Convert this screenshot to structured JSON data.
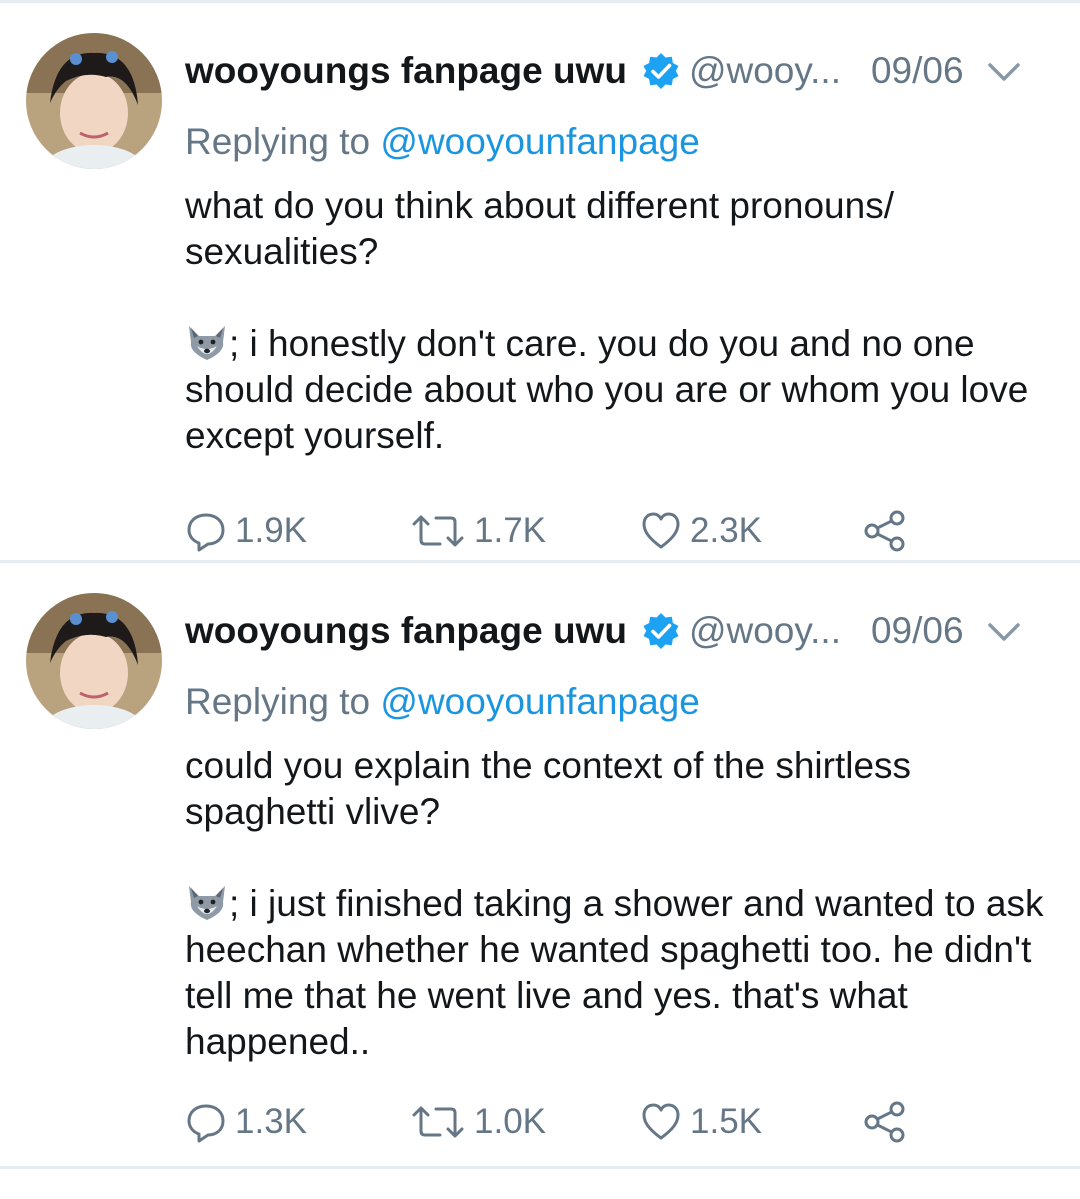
{
  "tweets": [
    {
      "author_name": "wooyoungs fanpage uwu",
      "handle": "@wooy...",
      "date": "09/06",
      "replying_prefix": "Replying to",
      "replying_to": "@wooyounfanpage",
      "question": "what do you think about different pronouns/ sexualities?",
      "answer": "; i honestly don't care. you do you and no one should decide about who you are or whom you love except yourself.",
      "answer_icon": "wolf-emoji",
      "replies": "1.9K",
      "retweets": "1.7K",
      "likes": "2.3K"
    },
    {
      "author_name": "wooyoungs fanpage uwu",
      "handle": "@wooy...",
      "date": "09/06",
      "replying_prefix": "Replying to",
      "replying_to": "@wooyounfanpage",
      "question": "could you explain the context of the shirtless spaghetti vlive?",
      "answer": "; i just finished taking a shower and wanted to ask heechan whether he wanted spaghetti too. he didn't tell me that he went live and yes. that's what happened..",
      "answer_icon": "wolf-emoji",
      "replies": "1.3K",
      "retweets": "1.0K",
      "likes": "1.5K"
    }
  ],
  "colors": {
    "text": "#14171a",
    "secondary": "#657786",
    "link": "#1b95e0",
    "verified": "#1da1f2",
    "divider": "#e6ecf0"
  }
}
